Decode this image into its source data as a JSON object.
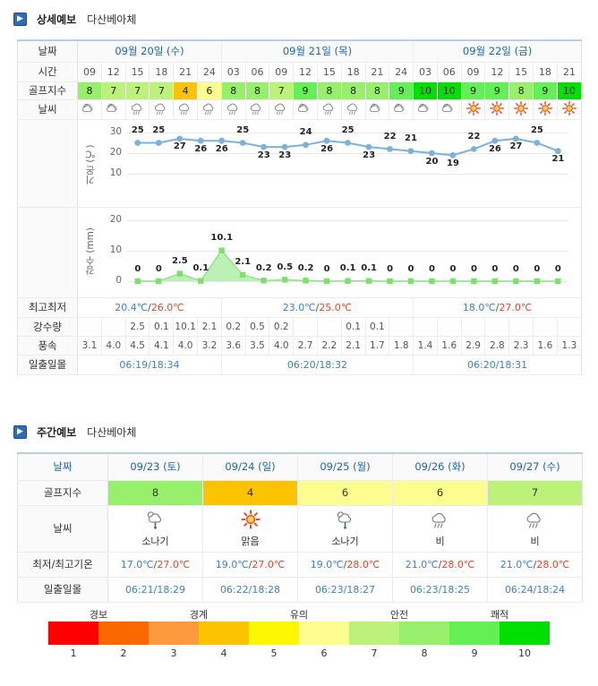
{
  "detail": {
    "arrow": "chevron-right-icon",
    "title": "상세예보",
    "course": "다산베아체",
    "labels": {
      "date": "날짜",
      "time": "시간",
      "golf_index": "골프지수",
      "weather": "날씨",
      "minmax": "최고최저",
      "rainfall": "강수량",
      "wind": "풍속",
      "sun": "일출일몰"
    },
    "days": [
      {
        "label": "09월 20일 (수)",
        "hours": [
          "09",
          "12",
          "15",
          "18",
          "21",
          "24"
        ],
        "minmax_low": "20.4℃",
        "minmax_high": "26.0℃",
        "sun": "06:19/18:34"
      },
      {
        "label": "09월 21일 (목)",
        "hours": [
          "03",
          "06",
          "09",
          "12",
          "15",
          "18",
          "21",
          "24"
        ],
        "minmax_low": "23.0℃",
        "minmax_high": "25.0℃",
        "sun": "06:20/18:32"
      },
      {
        "label": "09월 22일 (금)",
        "hours": [
          "03",
          "06",
          "09",
          "12",
          "15",
          "18",
          "21"
        ],
        "minmax_low": "18.0℃",
        "minmax_high": "27.0℃",
        "sun": "06:20/18:31"
      }
    ],
    "golf_index": [
      8,
      7,
      7,
      7,
      4,
      6,
      8,
      8,
      7,
      9,
      8,
      8,
      8,
      9,
      10,
      10,
      9,
      9,
      8,
      9,
      10
    ],
    "weather_icons": [
      "partly-cloudy",
      "partly-cloudy",
      "rain",
      "rain",
      "rain",
      "rain",
      "rain",
      "rain",
      "rain",
      "partly-cloudy",
      "rain",
      "rain",
      "partly-cloudy",
      "partly-cloudy",
      "partly-cloudy",
      "partly-cloudy",
      "sunny",
      "sunny",
      "sunny",
      "sunny",
      "sunny"
    ],
    "rainfall_row": [
      "",
      "",
      "2.5",
      "0.1",
      "10.1",
      "2.1",
      "0.2",
      "0.5",
      "0.2",
      "",
      "",
      "0.1",
      "0.1",
      "",
      "",
      "",
      "",
      "",
      "",
      "",
      ""
    ],
    "wind_row": [
      "3.1",
      "4.0",
      "4.5",
      "4.1",
      "4.0",
      "3.2",
      "3.6",
      "3.5",
      "4.0",
      "2.7",
      "2.2",
      "2.1",
      "1.7",
      "1.8",
      "1.4",
      "1.6",
      "2.9",
      "2.8",
      "2.3",
      "1.6",
      "1.3"
    ]
  },
  "weekly": {
    "arrow": "chevron-right-icon",
    "title": "주간예보",
    "course": "다산베아체",
    "labels": {
      "date": "날짜",
      "golf_index": "골프지수",
      "weather": "날씨",
      "minmax": "최저/최고기온",
      "sun": "일출일몰"
    },
    "days": [
      {
        "date": "09/23 (토)",
        "golf_index": 8,
        "icon": "shower",
        "weather_name": "소나기",
        "temp_low": "17.0℃",
        "temp_high": "27.0℃",
        "sun": "06:21/18:29"
      },
      {
        "date": "09/24 (일)",
        "golf_index": 4,
        "icon": "sunny",
        "weather_name": "맑음",
        "temp_low": "19.0℃",
        "temp_high": "27.0℃",
        "sun": "06:22/18:28"
      },
      {
        "date": "09/25 (월)",
        "golf_index": 6,
        "icon": "shower",
        "weather_name": "소나기",
        "temp_low": "19.0℃",
        "temp_high": "28.0℃",
        "sun": "06:23/18:27"
      },
      {
        "date": "09/26 (화)",
        "golf_index": 6,
        "icon": "rain",
        "weather_name": "비",
        "temp_low": "21.0℃",
        "temp_high": "28.0℃",
        "sun": "06:23/18:25"
      },
      {
        "date": "09/27 (수)",
        "golf_index": 7,
        "icon": "rain",
        "weather_name": "비",
        "temp_low": "21.0℃",
        "temp_high": "28.0℃",
        "sun": "06:24/18:24"
      }
    ]
  },
  "legend": {
    "labels": [
      "경보",
      "경계",
      "유의",
      "안전",
      "쾌적"
    ],
    "numbers": [
      "1",
      "2",
      "3",
      "4",
      "5",
      "6",
      "7",
      "8",
      "9",
      "10"
    ],
    "colors": [
      "#fe0000",
      "#fc6800",
      "#fc9a3d",
      "#fcc300",
      "#fdf800",
      "#fdfd8f",
      "#bcf27a",
      "#97ef6c",
      "#63ef55",
      "#00e000"
    ]
  },
  "index_colors": {
    "1": "#fe0000",
    "2": "#fc6800",
    "3": "#fc9a3d",
    "4": "#fcc300",
    "5": "#fdf800",
    "6": "#fdfd8f",
    "7": "#bcf27a",
    "8": "#97ef6c",
    "9": "#63ef55",
    "10": "#00e000"
  },
  "chart_data": [
    {
      "type": "line",
      "id": "temperature",
      "ylabel": "기온 (℃)",
      "ylim": [
        0,
        30
      ],
      "yticks": [
        10,
        20,
        30
      ],
      "grid": true,
      "color": "#7cb0dd",
      "x": [
        "09",
        "12",
        "15",
        "18",
        "21",
        "24",
        "03",
        "06",
        "09",
        "12",
        "15",
        "18",
        "21",
        "24",
        "03",
        "06",
        "09",
        "12",
        "15",
        "18",
        "21"
      ],
      "values": [
        25,
        25,
        27,
        26,
        26,
        25,
        23,
        23,
        24,
        26,
        25,
        23,
        22,
        21,
        20,
        19,
        22,
        26,
        27,
        25,
        21
      ],
      "label_above": [
        true,
        true,
        false,
        false,
        false,
        true,
        false,
        false,
        true,
        false,
        true,
        false,
        true,
        true,
        false,
        false,
        true,
        false,
        false,
        true,
        false
      ]
    },
    {
      "type": "area",
      "id": "rainfall",
      "ylabel": "강수 (mm)",
      "ylim": [
        0,
        20
      ],
      "yticks": [
        0,
        10,
        20
      ],
      "grid": true,
      "color": "#8fe089",
      "fill": "#b2eda8",
      "x": [
        "09",
        "12",
        "15",
        "18",
        "21",
        "24",
        "03",
        "06",
        "09",
        "12",
        "15",
        "18",
        "21",
        "24",
        "03",
        "06",
        "09",
        "12",
        "15",
        "18",
        "21"
      ],
      "values": [
        0,
        0,
        2.5,
        0.1,
        10.1,
        2.1,
        0.2,
        0.5,
        0.2,
        0,
        0.1,
        0.1,
        0,
        0,
        0,
        0,
        0,
        0,
        0,
        0,
        0
      ],
      "labels": [
        "0",
        "0",
        "2.5",
        "0.1",
        "10.1",
        "2.1",
        "0.2",
        "0.5",
        "0.2",
        "0",
        "0.1",
        "0.1",
        "0",
        "0",
        "0",
        "0",
        "0",
        "0",
        "0",
        "0",
        "0"
      ]
    }
  ]
}
